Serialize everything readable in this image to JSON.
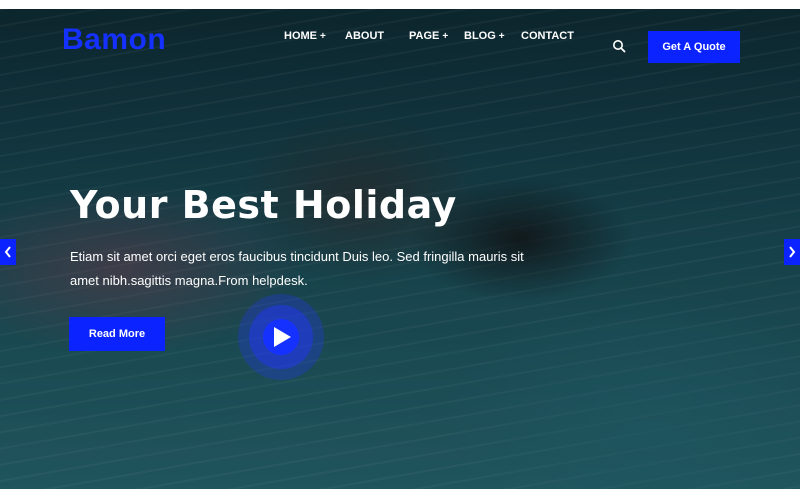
{
  "header": {
    "logo": "Bamon",
    "nav": [
      {
        "label": "HOME",
        "plus": "+"
      },
      {
        "label": "ABOUT",
        "plus": ""
      },
      {
        "label": "PAGE",
        "plus": "+"
      },
      {
        "label": "BLOG",
        "plus": "+"
      },
      {
        "label": "CONTACT",
        "plus": ""
      }
    ],
    "quote_label": "Get A Quote",
    "search_icon": "search-icon"
  },
  "hero": {
    "title": "Your Best Holiday",
    "description": "Etiam sit amet orci eget eros faucibus tincidunt Duis leo. Sed fringilla mauris sit amet nibh.sagittis magna.From helpdesk.",
    "read_more": "Read More",
    "play_icon": "play-icon"
  },
  "slider": {
    "prev_icon": "chevron-left-icon",
    "next_icon": "chevron-right-icon"
  },
  "colors": {
    "accent": "#0b23ff",
    "text": "#ffffff"
  }
}
